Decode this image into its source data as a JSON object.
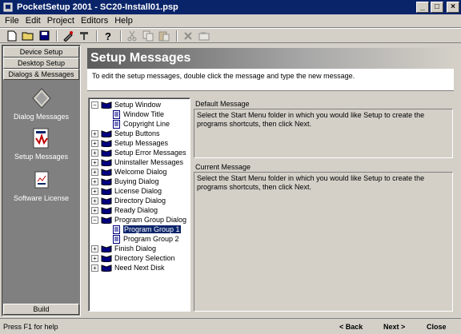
{
  "window": {
    "title": "PocketSetup 2001  -  SC20-Install01.psp",
    "controls": {
      "minimize": "_",
      "maximize": "□",
      "close": "×"
    }
  },
  "menu": [
    "File",
    "Edit",
    "Project",
    "Editors",
    "Help"
  ],
  "nav": {
    "buttons": [
      "Device Setup",
      "Desktop Setup",
      "Dialogs & Messages"
    ],
    "items": [
      {
        "label": "Dialog Messages",
        "icon": "dialog-messages-icon"
      },
      {
        "label": "Setup Messages",
        "icon": "setup-messages-icon"
      },
      {
        "label": "Software License",
        "icon": "software-license-icon"
      }
    ],
    "build": "Build"
  },
  "content": {
    "title": "Setup Messages",
    "instruction": "To edit the setup messages, double click the message and type the new message."
  },
  "tree": [
    {
      "label": "Setup Window",
      "expanded": true,
      "children": [
        "Window Title",
        "Copyright Line"
      ]
    },
    {
      "label": "Setup Buttons"
    },
    {
      "label": "Setup Messages"
    },
    {
      "label": "Setup Error Messages"
    },
    {
      "label": "Uninstaller Messages"
    },
    {
      "label": "Welcome Dialog"
    },
    {
      "label": "Buying Dialog"
    },
    {
      "label": "License Dialog"
    },
    {
      "label": "Directory Dialog"
    },
    {
      "label": "Ready Dialog"
    },
    {
      "label": "Program Group Dialog",
      "expanded": true,
      "children": [
        "Program Group 1",
        "Program Group 2"
      ],
      "selected_child": 0
    },
    {
      "label": "Finish Dialog"
    },
    {
      "label": "Directory Selection"
    },
    {
      "label": "Need Next Disk"
    }
  ],
  "default_message": {
    "label": "Default Message",
    "text": "Select the Start Menu folder in which you would like Setup to create the programs shortcuts, then click Next."
  },
  "current_message": {
    "label": "Current Message",
    "text": "Select the Start Menu folder in which you would like Setup to create the programs shortcuts, then click Next."
  },
  "status": {
    "text": "Press F1 for help",
    "back": "< Back",
    "next": "Next >",
    "close": "Close"
  }
}
